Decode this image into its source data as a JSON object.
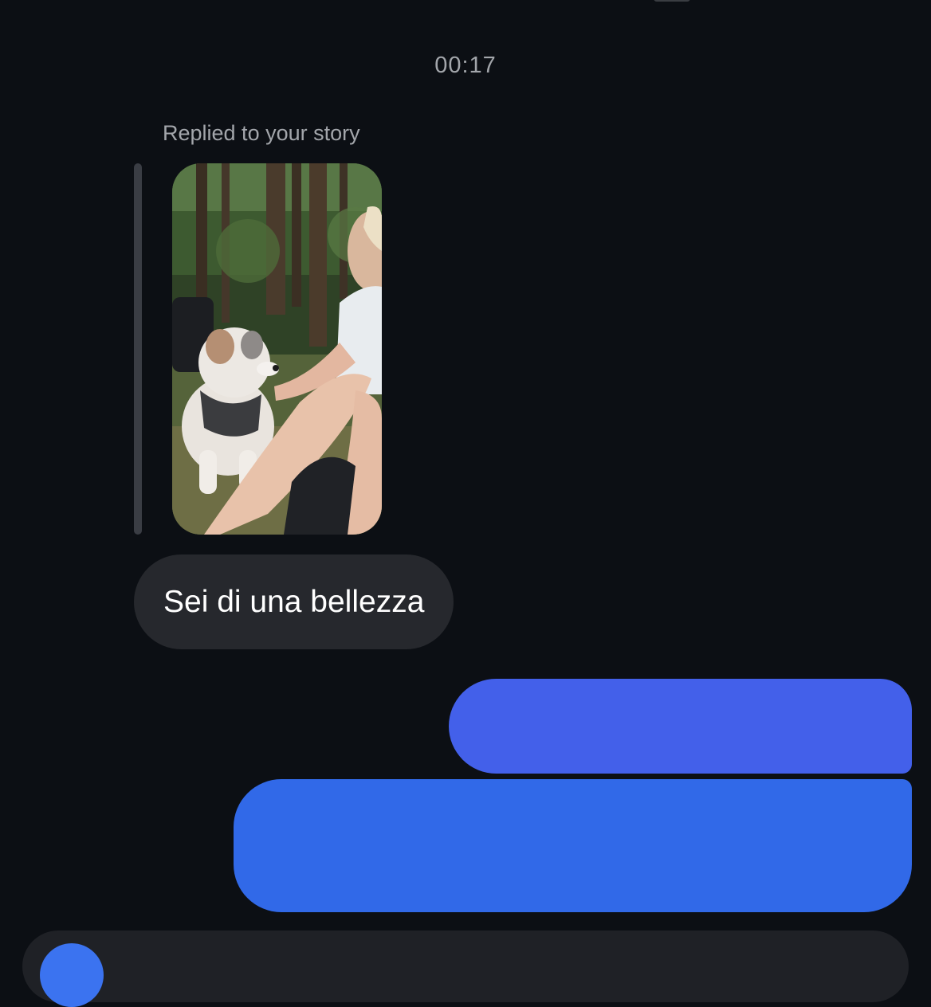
{
  "thread": {
    "timestamp": "00:17",
    "story_reply": {
      "label": "Replied to your story",
      "thumbnail": "story-photo"
    },
    "messages": [
      {
        "from": "them",
        "text": "Sei di una bellezza"
      },
      {
        "from": "me",
        "text": ""
      },
      {
        "from": "me",
        "text": ""
      }
    ]
  },
  "composer": {
    "camera_icon": "camera-icon"
  },
  "colors": {
    "background": "#0c0f14",
    "received_bubble": "#26282d",
    "sent_bubble": "#3169e8",
    "muted_text": "#a3a6ab"
  }
}
